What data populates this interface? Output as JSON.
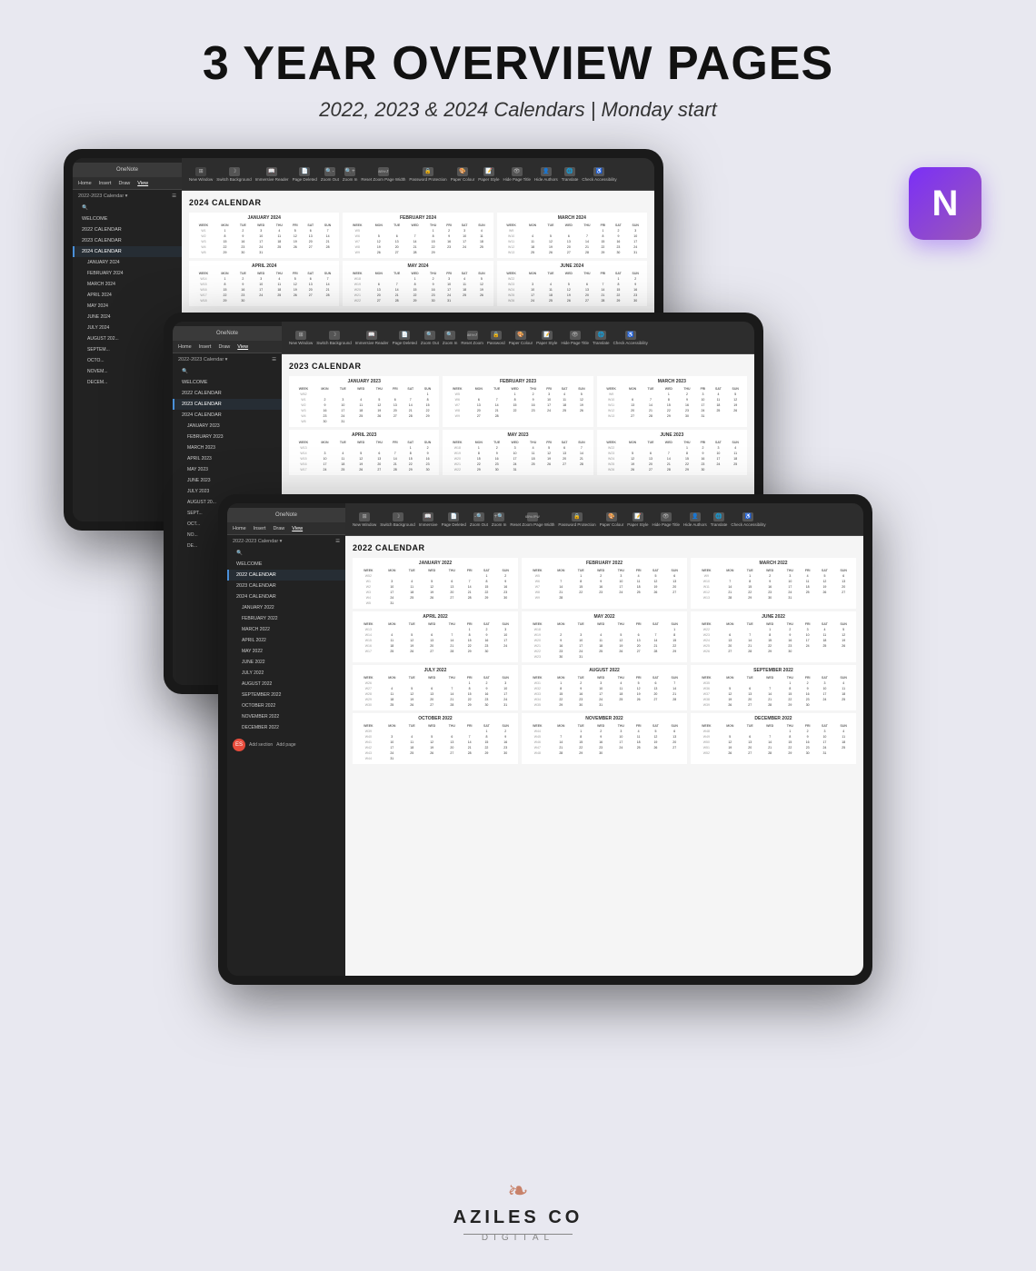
{
  "header": {
    "title": "3 YEAR OVERVIEW PAGES",
    "subtitle": "2022, 2023 & 2024 Calendars | Monday start"
  },
  "tablets": {
    "top": {
      "title": "OneNote",
      "year": "2024",
      "calLabel": "2024 CALENDAR",
      "sidebar": {
        "header": "2022-2023 Calendar",
        "items": [
          "WELCOME",
          "2022 CALENDAR",
          "2023 CALENDAR",
          "2024 CALENDAR",
          "JANUARY 2024",
          "FEBRUARY 2024",
          "MARCH 2024",
          "APRIL 2024",
          "MAY 2024",
          "JUNE 2024",
          "JULY 2024",
          "AUGUST 2...",
          "SEPTEM...",
          "OCTO...",
          "NOVEM...",
          "DECEM..."
        ]
      }
    },
    "mid": {
      "title": "OneNote",
      "year": "2023",
      "calLabel": "2023 CALENDAR",
      "sidebar": {
        "items": [
          "WELCOME",
          "2022 CALENDAR",
          "2023 CALENDAR",
          "2024 CALENDAR",
          "JANUARY 2023",
          "FEBRUARY 2023",
          "MARCH 2023",
          "APRIL 2023",
          "MAY 2023",
          "JUNE 2023",
          "JULY 2023",
          "AUGUST 20...",
          "SEPT...",
          "OCT...",
          "NO...",
          "DE..."
        ]
      }
    },
    "bot": {
      "title": "OneNote",
      "year": "2022",
      "calLabel": "2022 CALENDAR",
      "sidebar": {
        "items": [
          "WELCOME",
          "2022 CALENDAR",
          "2023 CALENDAR",
          "2024 CALENDAR",
          "JANUARY 2022",
          "FEBRUARY 2022",
          "MARCH 2022",
          "APRIL 2022",
          "MAY 2022",
          "JUNE 2022",
          "JULY 2022",
          "AUGUST 2022",
          "SEPTEMBER 2022",
          "OCTOBER 2022",
          "NOVEMBER 2022",
          "DECEMBER 2022"
        ]
      }
    }
  },
  "brand": {
    "name": "AZILES CO",
    "sub": "DIGITAL",
    "icon": "❧"
  }
}
